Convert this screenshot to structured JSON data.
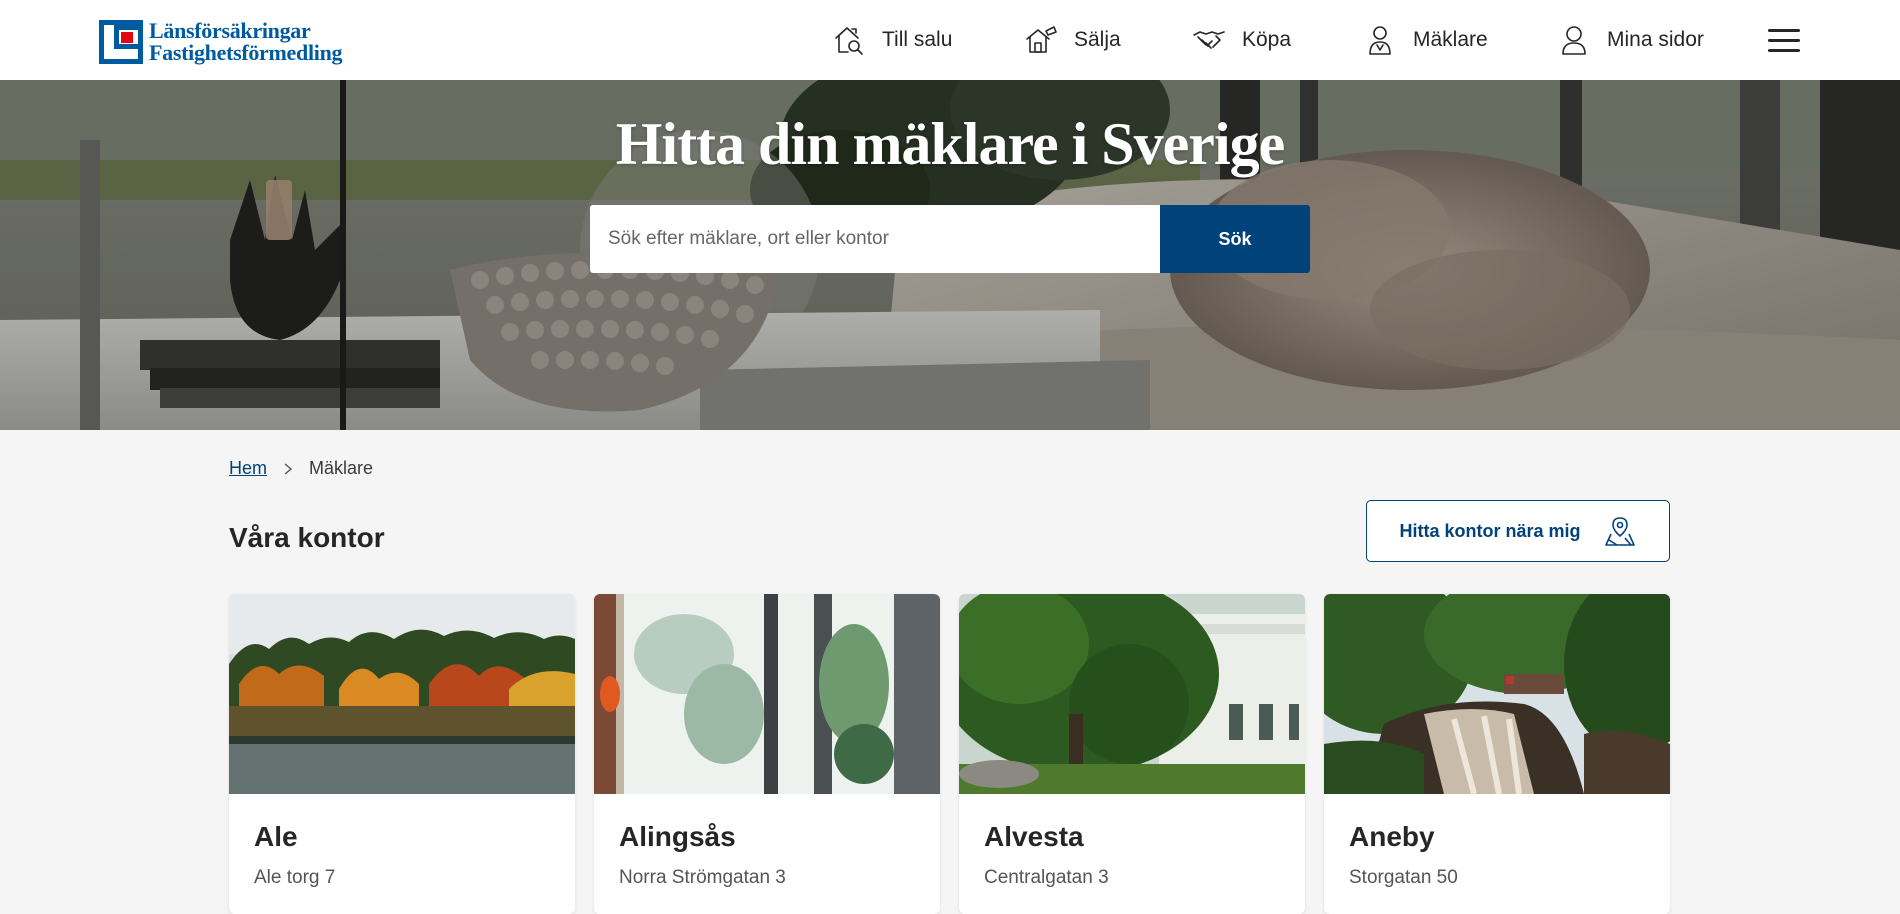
{
  "brand": {
    "name_line1": "Länsförsäkringar",
    "name_line2": "Fastighetsförmedling",
    "color": "#005aa0"
  },
  "nav": {
    "items": [
      {
        "label": "Till salu",
        "icon": "house-search-icon"
      },
      {
        "label": "Sälja",
        "icon": "house-sell-icon"
      },
      {
        "label": "Köpa",
        "icon": "handshake-icon"
      },
      {
        "label": "Mäklare",
        "icon": "agent-icon"
      },
      {
        "label": "Mina sidor",
        "icon": "user-icon"
      }
    ],
    "menu_icon": "hamburger-menu-icon"
  },
  "hero": {
    "title": "Hitta din mäklare i Sverige",
    "search_placeholder": "Sök efter mäklare, ort eller kontor",
    "search_value": "",
    "search_button": "Sök"
  },
  "breadcrumb": {
    "home": "Hem",
    "current": "Mäklare"
  },
  "section": {
    "title": "Våra kontor",
    "near_button": "Hitta kontor nära mig",
    "near_icon": "map-pin-icon"
  },
  "offices": [
    {
      "name": "Ale",
      "address": "Ale torg 7",
      "image": "autumn-lake-photo"
    },
    {
      "name": "Alingsås",
      "address": "Norra Strömgatan 3",
      "image": "window-interior-photo"
    },
    {
      "name": "Alvesta",
      "address": "Centralgatan 3",
      "image": "tree-white-building-photo"
    },
    {
      "name": "Aneby",
      "address": "Storgatan 50",
      "image": "waterfall-forest-photo"
    }
  ],
  "colors": {
    "primary": "#00427a",
    "background": "#f5f5f5",
    "text": "#262626"
  }
}
